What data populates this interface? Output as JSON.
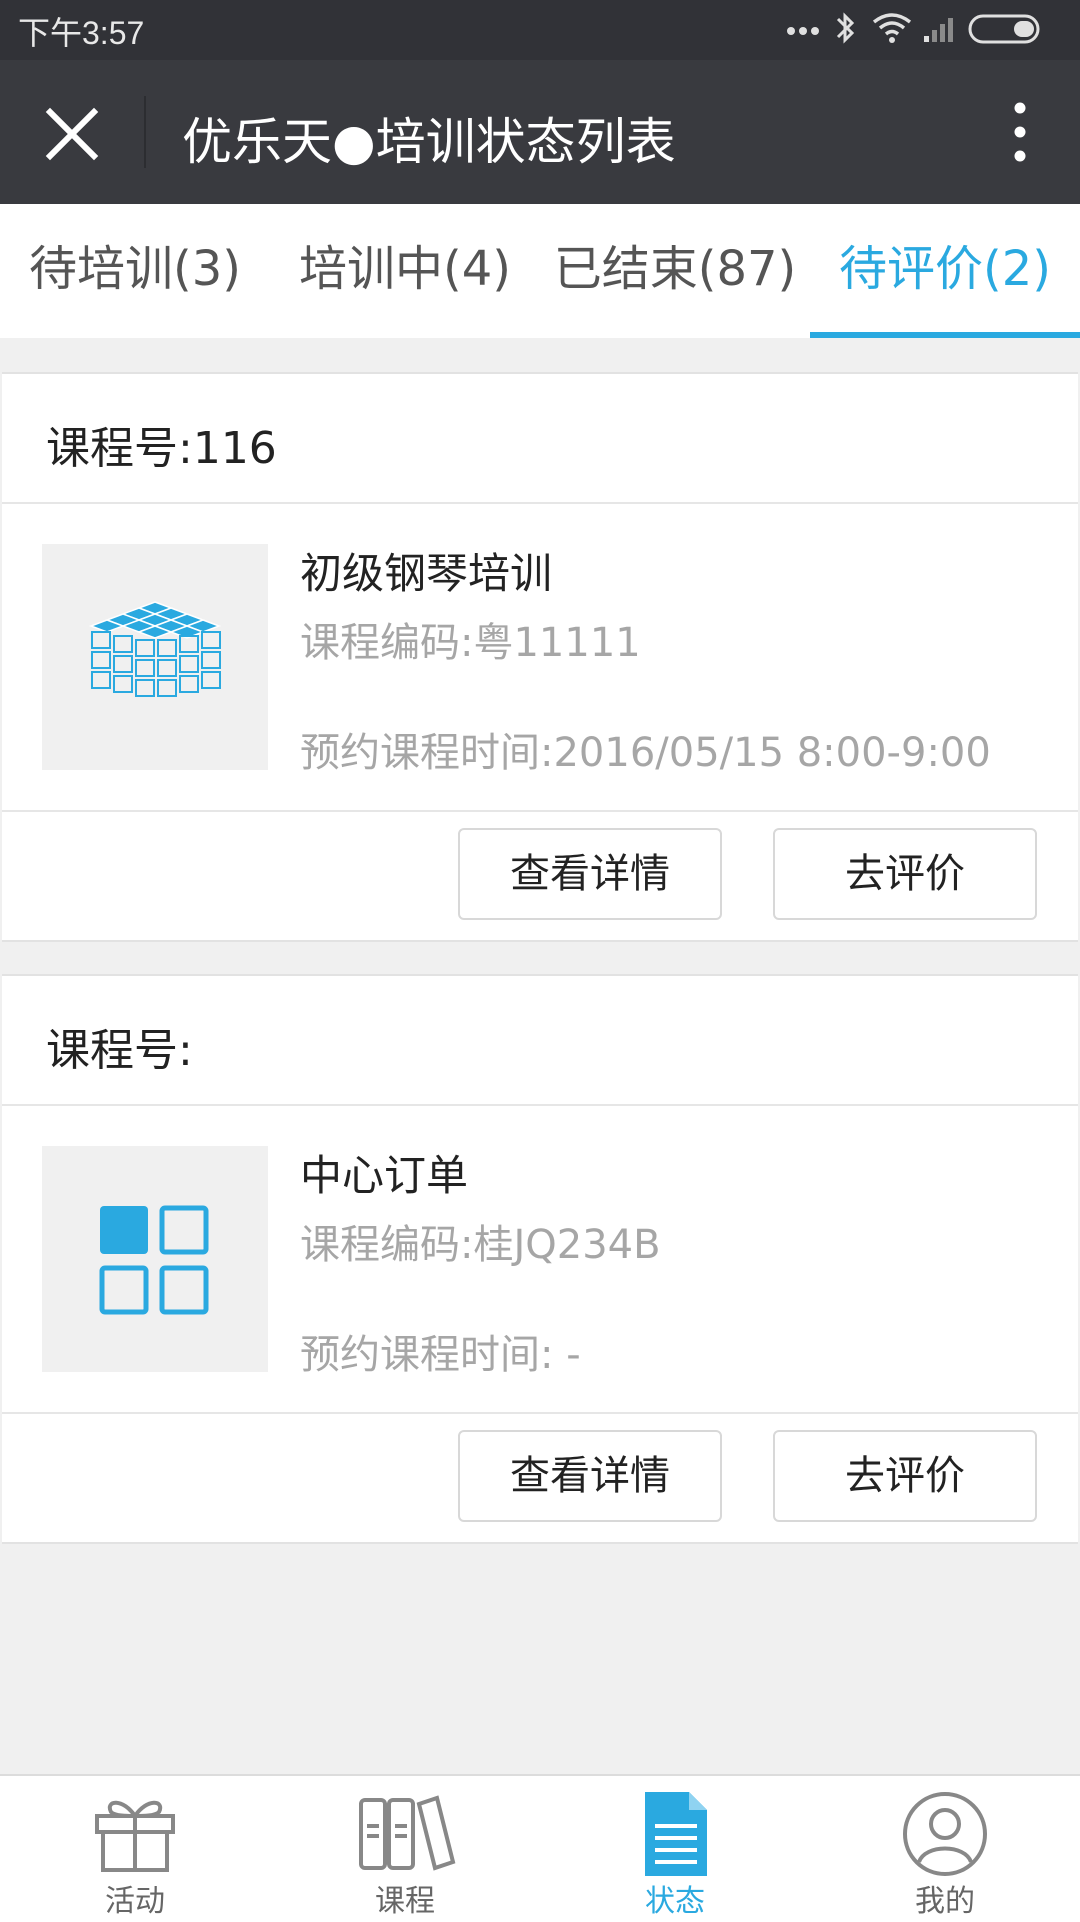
{
  "status_bar": {
    "time": "下午3:57"
  },
  "title_bar": {
    "title": "优乐天●培训状态列表",
    "close_icon": "close-icon",
    "more_icon": "more-vertical-icon"
  },
  "tabs": [
    {
      "label": "待培训(3)",
      "active": false
    },
    {
      "label": "培训中(4)",
      "active": false
    },
    {
      "label": "已结束(87)",
      "active": false
    },
    {
      "label": "待评价(2)",
      "active": true
    }
  ],
  "cards": [
    {
      "header": "课程号:116",
      "thumb_icon": "cube-grid-icon",
      "name": "初级钢琴培训",
      "code": "课程编码:粤11111",
      "time": "预约课程时间:2016/05/15 8:00-9:00",
      "detail_label": "查看详情",
      "review_label": "去评价"
    },
    {
      "header": "课程号:",
      "thumb_icon": "app-grid-icon",
      "name": "中心订单",
      "code": "课程编码:桂JQ234B",
      "time": "预约课程时间: -",
      "detail_label": "查看详情",
      "review_label": "去评价"
    }
  ],
  "bottom_nav": [
    {
      "label": "活动",
      "icon": "gift-icon",
      "active": false
    },
    {
      "label": "课程",
      "icon": "books-icon",
      "active": false
    },
    {
      "label": "状态",
      "icon": "document-icon",
      "active": true
    },
    {
      "label": "我的",
      "icon": "user-icon",
      "active": false
    }
  ],
  "colors": {
    "accent": "#2aa9e0",
    "title_bar": "#393a3f",
    "status_bar": "#313237",
    "background": "#f0f0f0"
  }
}
